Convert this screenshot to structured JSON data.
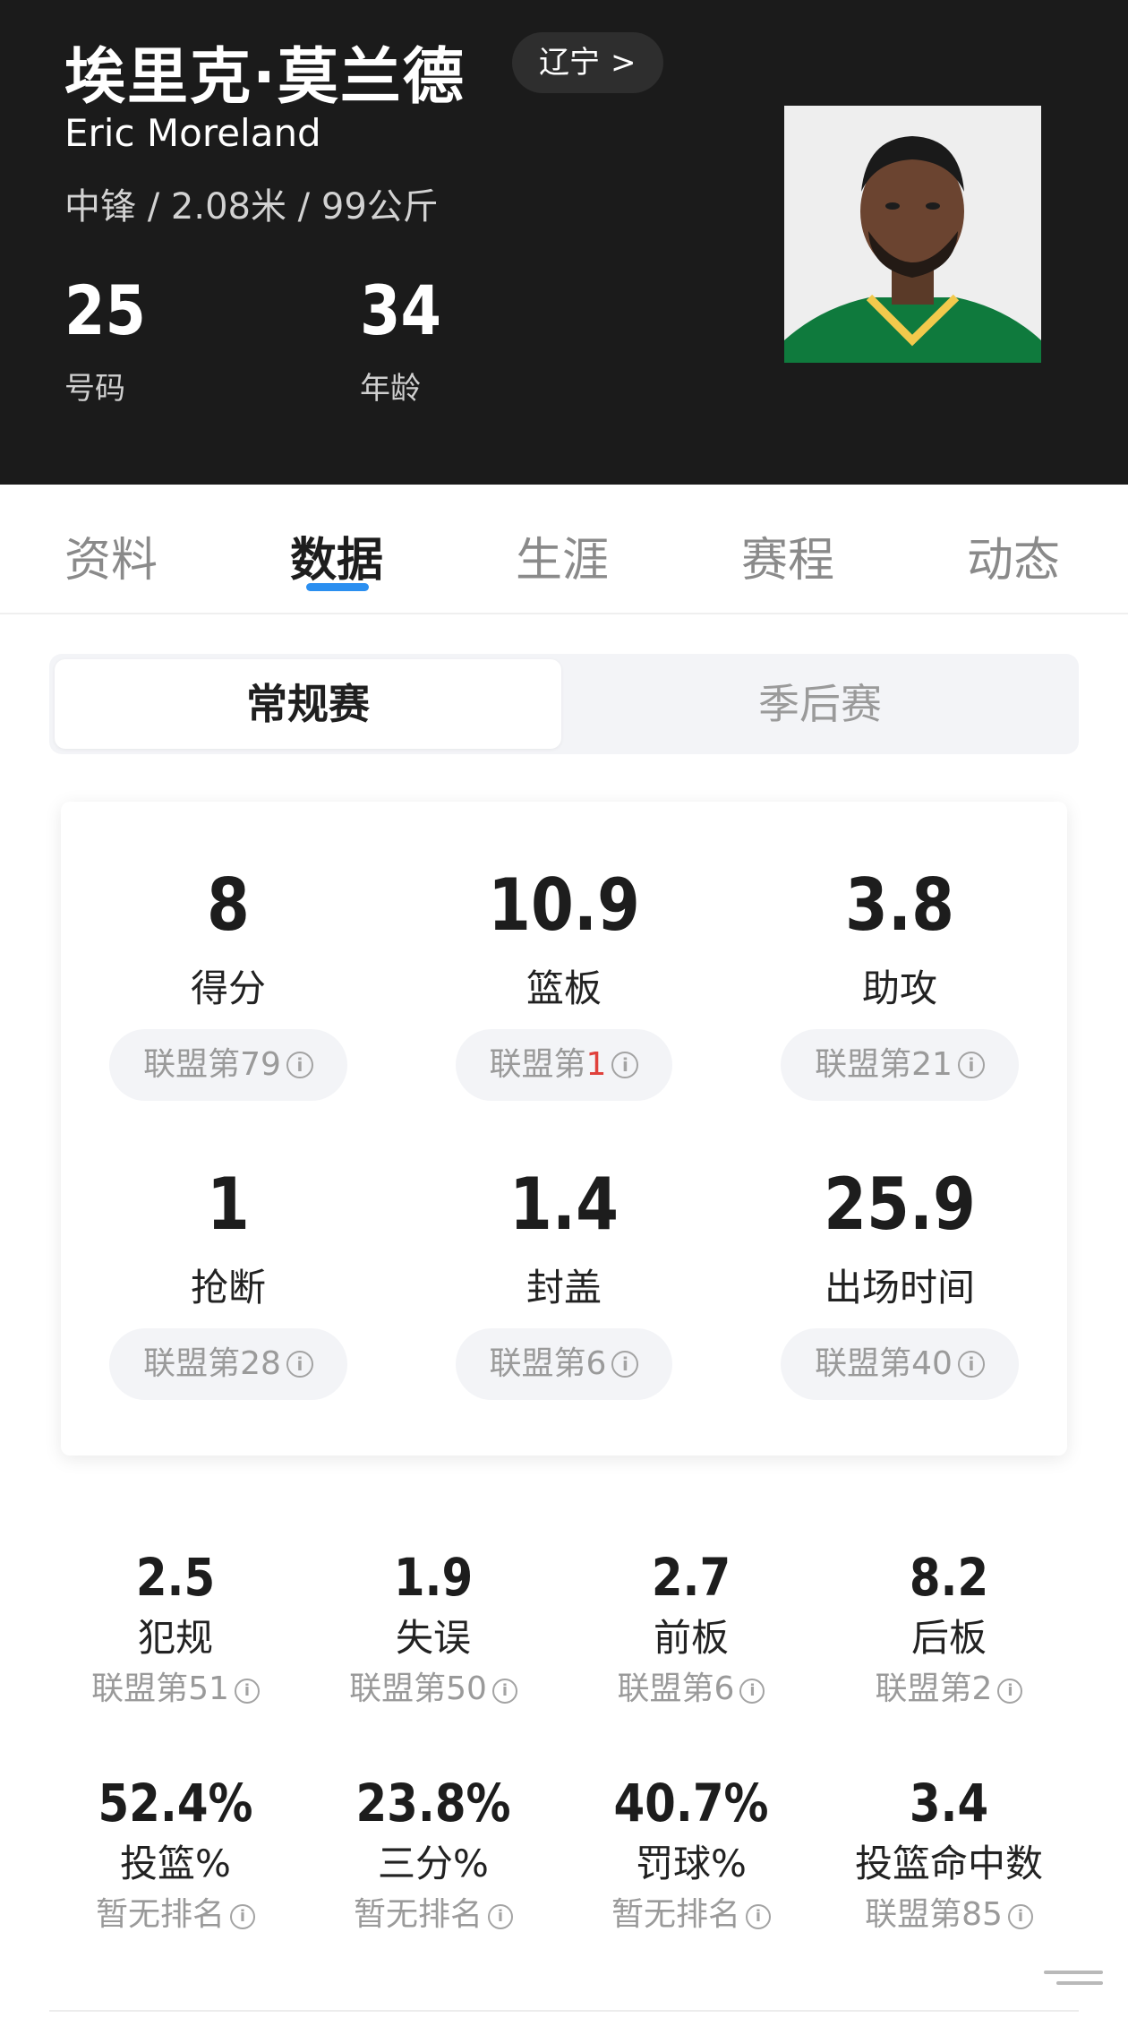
{
  "player": {
    "name_cn": "埃里克·莫兰德",
    "team_label": "辽宁",
    "team_chevron": ">",
    "name_en": "Eric Moreland",
    "meta": "中锋 / 2.08米 / 99公斤",
    "number_value": "25",
    "number_label": "号码",
    "age_value": "34",
    "age_label": "年龄"
  },
  "tabs": [
    "资料",
    "数据",
    "生涯",
    "赛程",
    "动态"
  ],
  "active_tab": "数据",
  "season_toggle": {
    "regular": "常规赛",
    "playoffs": "季后赛"
  },
  "main_stats": [
    {
      "value": "8",
      "label": "得分",
      "rank_prefix": "联盟第",
      "rank": "79",
      "highlight": false
    },
    {
      "value": "10.9",
      "label": "篮板",
      "rank_prefix": "联盟第",
      "rank": "1",
      "highlight": true
    },
    {
      "value": "3.8",
      "label": "助攻",
      "rank_prefix": "联盟第",
      "rank": "21",
      "highlight": false
    },
    {
      "value": "1",
      "label": "抢断",
      "rank_prefix": "联盟第",
      "rank": "28",
      "highlight": false
    },
    {
      "value": "1.4",
      "label": "封盖",
      "rank_prefix": "联盟第",
      "rank": "6",
      "highlight": false
    },
    {
      "value": "25.9",
      "label": "出场时间",
      "rank_prefix": "联盟第",
      "rank": "40",
      "highlight": false
    }
  ],
  "secondary_stats": [
    {
      "value": "2.5",
      "label": "犯规",
      "rank": "联盟第51"
    },
    {
      "value": "1.9",
      "label": "失误",
      "rank": "联盟第50"
    },
    {
      "value": "2.7",
      "label": "前板",
      "rank": "联盟第6"
    },
    {
      "value": "8.2",
      "label": "后板",
      "rank": "联盟第2"
    },
    {
      "value": "52.4%",
      "label": "投篮%",
      "rank": "暂无排名"
    },
    {
      "value": "23.8%",
      "label": "三分%",
      "rank": "暂无排名"
    },
    {
      "value": "40.7%",
      "label": "罚球%",
      "rank": "暂无排名"
    },
    {
      "value": "3.4",
      "label": "投篮命中数",
      "rank": "联盟第85"
    }
  ],
  "info_icon_glyph": "i",
  "icons": {
    "rank_info": "info-circle-icon"
  },
  "colors": {
    "accent": "#2b8ff0",
    "rank_highlight": "#e0413c",
    "header_bg": "#1b1b1b"
  }
}
